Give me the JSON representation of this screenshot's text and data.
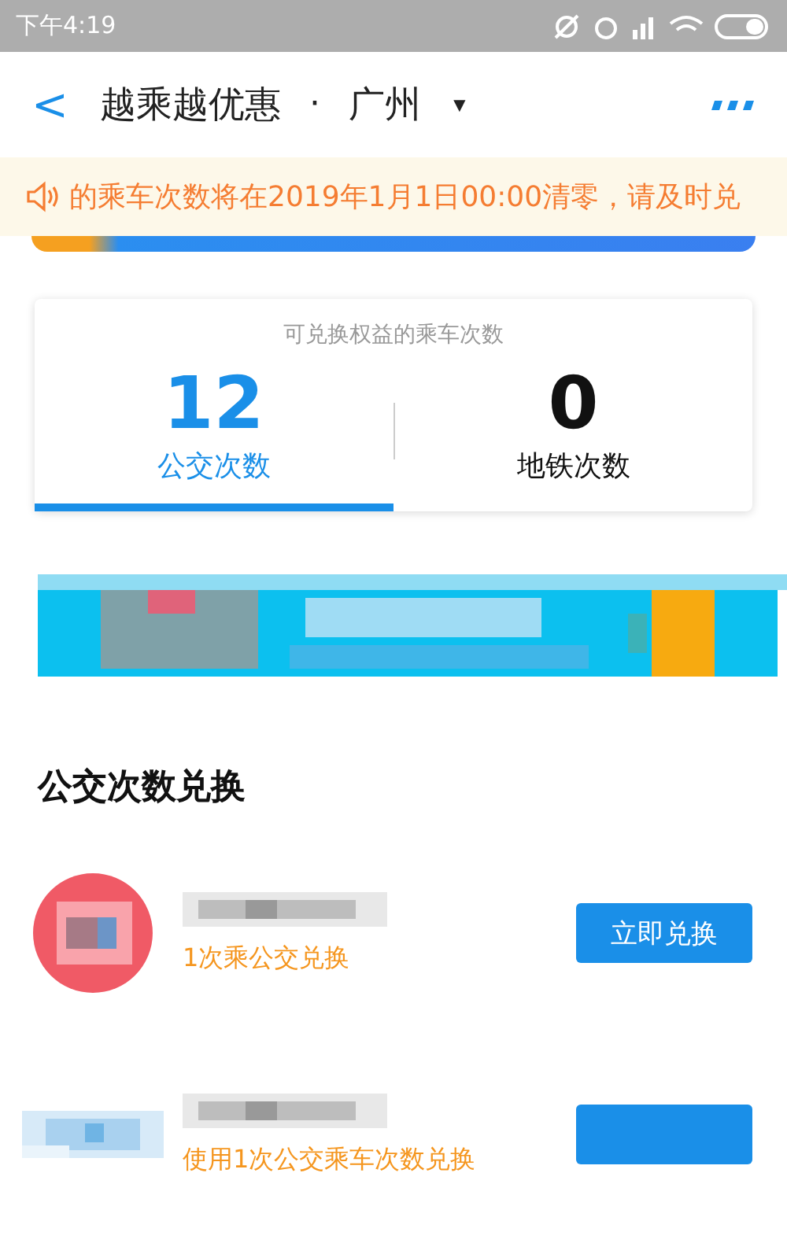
{
  "status_bar": {
    "time": "下午4:19"
  },
  "header": {
    "back": "<",
    "title": "越乘越优惠",
    "separator": "·",
    "city": "广州",
    "dropdown": "▼"
  },
  "notice": {
    "text": "的乘车次数将在2019年1月1日00:00清零，请及时兑"
  },
  "counts": {
    "title": "可兑换权益的乘车次数",
    "tabs": [
      {
        "value": "12",
        "label": "公交次数",
        "selected": true
      },
      {
        "value": "0",
        "label": "地铁次数",
        "selected": false
      }
    ]
  },
  "section": {
    "title": "公交次数兑换"
  },
  "offers": [
    {
      "subtitle": "1次乘公交兑换",
      "button": "立即兑换"
    },
    {
      "subtitle": "使用1次公交乘车次数兑换"
    }
  ]
}
